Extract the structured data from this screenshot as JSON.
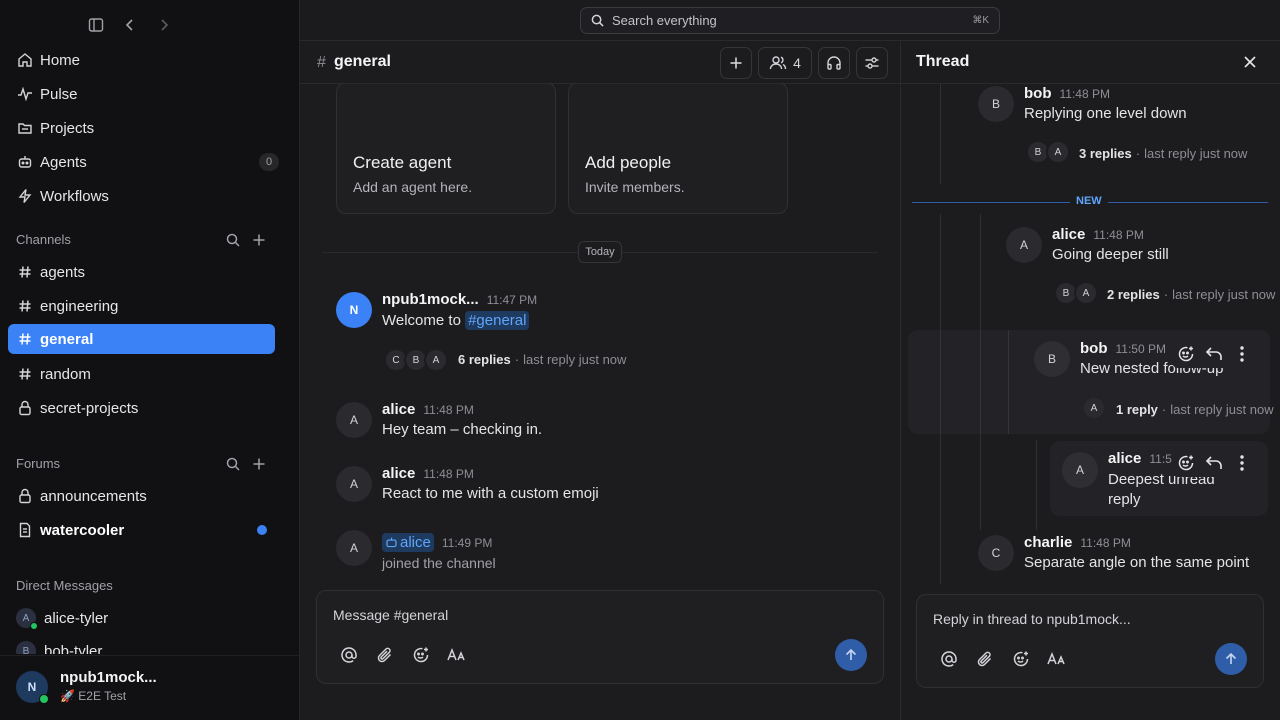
{
  "sidebar": {
    "nav": [
      {
        "label": "Home",
        "icon": "home-icon"
      },
      {
        "label": "Pulse",
        "icon": "pulse-icon"
      },
      {
        "label": "Projects",
        "icon": "projects-icon"
      },
      {
        "label": "Agents",
        "icon": "agents-icon",
        "count": "0"
      },
      {
        "label": "Workflows",
        "icon": "workflows-icon"
      }
    ],
    "channels_label": "Channels",
    "channels": [
      {
        "label": "agents"
      },
      {
        "label": "engineering"
      },
      {
        "label": "general"
      },
      {
        "label": "random"
      },
      {
        "label": "secret-projects"
      }
    ],
    "forums_label": "Forums",
    "forums": [
      {
        "label": "announcements"
      },
      {
        "label": "watercooler"
      }
    ],
    "dm_label": "Direct Messages",
    "dms": [
      {
        "label": "alice-tyler",
        "initial": "A"
      },
      {
        "label": "bob-tyler",
        "initial": "B"
      }
    ],
    "user": {
      "initial": "N",
      "name": "npub1mock...",
      "status": "E2E Test",
      "status_emoji": "🚀"
    }
  },
  "search": {
    "placeholder": "Search everything",
    "shortcut": "⌘K"
  },
  "channel": {
    "hash": "#",
    "name": "general",
    "member_count": "4",
    "cards": [
      {
        "title": "Create agent",
        "subtitle": "Add an agent here."
      },
      {
        "title": "Add people",
        "subtitle": "Invite members."
      }
    ],
    "date_divider": "Today",
    "messages": [
      {
        "initial": "N",
        "author": "npub1mock...",
        "time": "11:47 PM",
        "text": "Welcome to ",
        "mention": "#general",
        "replies": "6 replies",
        "last": "last reply just now",
        "reply_avatars": [
          "C",
          "B",
          "A"
        ]
      },
      {
        "initial": "A",
        "author": "alice",
        "time": "11:48 PM",
        "text": "Hey team – checking in."
      },
      {
        "initial": "A",
        "author": "alice",
        "time": "11:48 PM",
        "text": "React to me with a custom emoji"
      },
      {
        "initial": "A",
        "author": "alice",
        "time": "11:49 PM",
        "text": "joined the channel"
      }
    ],
    "composer_placeholder": "Message #general"
  },
  "thread": {
    "title": "Thread",
    "new_label": "NEW",
    "messages": [
      {
        "initial": "B",
        "author": "bob",
        "time": "11:48 PM",
        "text": "Replying one level down",
        "replies": "3 replies",
        "last": "last reply just now",
        "reply_avatars": [
          "B",
          "A"
        ]
      },
      {
        "initial": "A",
        "author": "alice",
        "time": "11:48 PM",
        "text": "Going deeper still",
        "replies": "2 replies",
        "last": "last reply just now",
        "reply_avatars": [
          "B",
          "A"
        ]
      },
      {
        "initial": "B",
        "author": "bob",
        "time": "11:50 PM",
        "text": "New nested follow-up",
        "replies": "1 reply",
        "last": "last reply just now",
        "reply_avatars": [
          "A"
        ]
      },
      {
        "initial": "A",
        "author": "alice",
        "time": "11:5",
        "text": "Deepest unread reply"
      },
      {
        "initial": "C",
        "author": "charlie",
        "time": "11:48 PM",
        "text": "Separate angle on the same point"
      }
    ],
    "composer_placeholder": "Reply in thread to npub1mock..."
  },
  "colors": {
    "accent": "#3b82f6",
    "online": "#22c55e",
    "background": "#1c1c1f",
    "sidebar": "#111113"
  }
}
